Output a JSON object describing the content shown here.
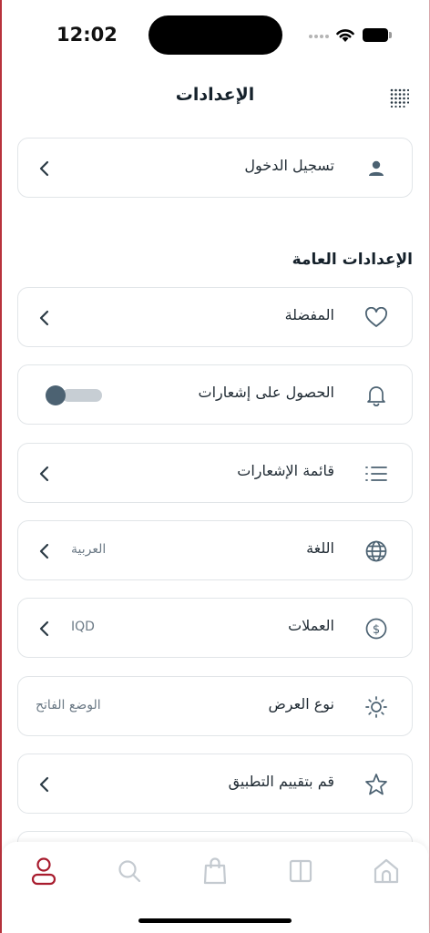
{
  "status_bar": {
    "time": "12:02"
  },
  "header": {
    "title": "الإعدادات"
  },
  "login": {
    "label": "تسجيل الدخول"
  },
  "general": {
    "title": "الإعدادات العامة",
    "items": [
      {
        "label": "المفضلة",
        "icon": "heart-icon"
      },
      {
        "label": "الحصول على إشعارات",
        "icon": "bell-icon",
        "toggle": false
      },
      {
        "label": "قائمة الإشعارات",
        "icon": "list-icon"
      },
      {
        "label": "اللغة",
        "icon": "globe-icon",
        "value": "العربية"
      },
      {
        "label": "العملات",
        "icon": "dollar-icon",
        "value": "IQD"
      },
      {
        "label": "نوع العرض",
        "icon": "sun-icon",
        "value": "الوضع الفاتح"
      },
      {
        "label": "قم بتقييم التطبيق",
        "icon": "star-icon"
      }
    ]
  },
  "bottom_nav": {
    "items": [
      "profile-icon",
      "search-icon",
      "bag-icon",
      "book-icon",
      "home-icon"
    ],
    "active": "profile-icon"
  },
  "colors": {
    "accent": "#a81c2e",
    "icon": "#4c6272",
    "text": "#1f2a33",
    "muted": "#6c7a86",
    "border": "#e1e5e8"
  }
}
